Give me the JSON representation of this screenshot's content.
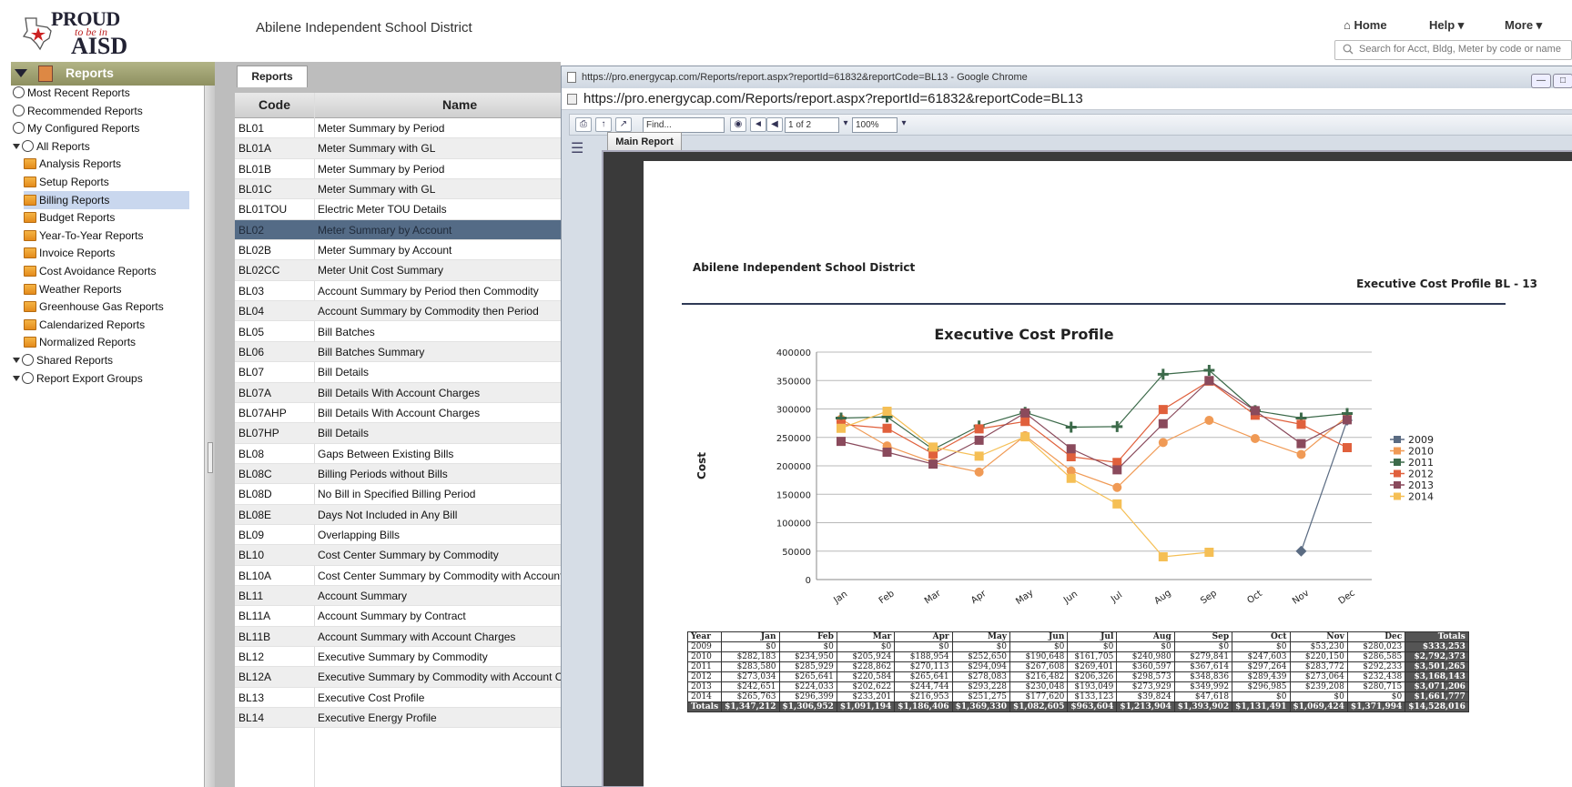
{
  "header": {
    "logo": {
      "line1": "PROUD",
      "line2": "to be in",
      "line3": "AISD"
    },
    "org_title": "Abilene Independent School District",
    "nav": {
      "home": "Home",
      "help": "Help",
      "more": "More"
    },
    "search_placeholder": "Search for Acct, Bldg, Meter by code or name"
  },
  "sidebar": {
    "title": "Reports",
    "items": [
      {
        "label": "Most Recent Reports",
        "icon": "clock-icon",
        "indent": 0
      },
      {
        "label": "Recommended Reports",
        "icon": "star-doc-icon",
        "indent": 0
      },
      {
        "label": "My Configured Reports",
        "icon": "gear-users-icon",
        "indent": 0
      },
      {
        "label": "All Reports",
        "icon": "reports-group-icon",
        "indent": 0,
        "expanded": true
      },
      {
        "label": "Analysis Reports",
        "icon": "folder-icon",
        "indent": 1
      },
      {
        "label": "Setup Reports",
        "icon": "folder-icon",
        "indent": 1
      },
      {
        "label": "Billing Reports",
        "icon": "folder-icon",
        "indent": 1,
        "selected": true
      },
      {
        "label": "Budget Reports",
        "icon": "folder-icon",
        "indent": 1
      },
      {
        "label": "Year-To-Year Reports",
        "icon": "folder-icon",
        "indent": 1
      },
      {
        "label": "Invoice Reports",
        "icon": "folder-icon",
        "indent": 1
      },
      {
        "label": "Cost Avoidance Reports",
        "icon": "folder-icon",
        "indent": 1
      },
      {
        "label": "Weather Reports",
        "icon": "folder-icon",
        "indent": 1
      },
      {
        "label": "Greenhouse Gas Reports",
        "icon": "folder-icon",
        "indent": 1
      },
      {
        "label": "Calendarized Reports",
        "icon": "folder-icon",
        "indent": 1
      },
      {
        "label": "Normalized Reports",
        "icon": "folder-icon",
        "indent": 1
      },
      {
        "label": "Shared Reports",
        "icon": "shared-icon",
        "indent": 0,
        "expanded": true
      },
      {
        "label": "Report Export Groups",
        "icon": "export-icon",
        "indent": 0,
        "expanded": true
      }
    ]
  },
  "report_list": {
    "tab": "Reports",
    "columns": {
      "code": "Code",
      "name": "Name"
    },
    "rows": [
      {
        "code": "BL01",
        "name": "Meter Summary by Period"
      },
      {
        "code": "BL01A",
        "name": "Meter Summary with GL"
      },
      {
        "code": "BL01B",
        "name": "Meter Summary by Period"
      },
      {
        "code": "BL01C",
        "name": "Meter Summary with GL"
      },
      {
        "code": "BL01TOU",
        "name": "Electric Meter TOU Details"
      },
      {
        "code": "BL02",
        "name": "Meter Summary by Account",
        "selected": true
      },
      {
        "code": "BL02B",
        "name": "Meter Summary by Account"
      },
      {
        "code": "BL02CC",
        "name": "Meter Unit Cost Summary"
      },
      {
        "code": "BL03",
        "name": "Account Summary by Period then Commodity"
      },
      {
        "code": "BL04",
        "name": "Account Summary by Commodity then Period"
      },
      {
        "code": "BL05",
        "name": "Bill Batches"
      },
      {
        "code": "BL06",
        "name": "Bill Batches Summary"
      },
      {
        "code": "BL07",
        "name": "Bill Details"
      },
      {
        "code": "BL07A",
        "name": "Bill Details With Account Charges"
      },
      {
        "code": "BL07AHP",
        "name": "Bill Details With Account Charges"
      },
      {
        "code": "BL07HP",
        "name": "Bill Details"
      },
      {
        "code": "BL08",
        "name": "Gaps Between Existing Bills"
      },
      {
        "code": "BL08C",
        "name": "Billing Periods without Bills"
      },
      {
        "code": "BL08D",
        "name": "No Bill in Specified Billing Period"
      },
      {
        "code": "BL08E",
        "name": "Days Not Included in Any Bill"
      },
      {
        "code": "BL09",
        "name": "Overlapping Bills"
      },
      {
        "code": "BL10",
        "name": "Cost Center Summary by Commodity"
      },
      {
        "code": "BL10A",
        "name": "Cost Center Summary by Commodity with Account"
      },
      {
        "code": "BL11",
        "name": "Account Summary"
      },
      {
        "code": "BL11A",
        "name": "Account Summary by Contract"
      },
      {
        "code": "BL11B",
        "name": "Account Summary with Account Charges"
      },
      {
        "code": "BL12",
        "name": "Executive Summary by Commodity"
      },
      {
        "code": "BL12A",
        "name": "Executive Summary by Commodity with Account C"
      },
      {
        "code": "BL13",
        "name": "Executive Cost Profile"
      },
      {
        "code": "BL14",
        "name": "Executive Energy Profile"
      }
    ]
  },
  "browser": {
    "window_title": "https://pro.energycap.com/Reports/report.aspx?reportId=61832&reportCode=BL13 - Google Chrome",
    "url": "https://pro.energycap.com/Reports/report.aspx?reportId=61832&reportCode=BL13",
    "toolbar": {
      "find_placeholder": "Find...",
      "page": "1 of 2",
      "zoom": "100%"
    },
    "doc_tab": "Main Report"
  },
  "report": {
    "org": "Abilene Independent School District",
    "code_title": "Executive Cost Profile BL - 13"
  },
  "colors": {
    "2009": "#5a6b82",
    "2010": "#f09a55",
    "2011": "#3c6a4a",
    "2012": "#e0603c",
    "2013": "#8a4a5c",
    "2014": "#f5bf55"
  },
  "chart_data": {
    "type": "line",
    "title": "Executive Cost Profile",
    "xlabel": "",
    "ylabel": "Cost",
    "ylim": [
      0,
      400000
    ],
    "yticks": [
      0,
      50000,
      100000,
      150000,
      200000,
      250000,
      300000,
      350000,
      400000
    ],
    "grid": true,
    "legend": "right",
    "categories": [
      "Jan",
      "Feb",
      "Mar",
      "Apr",
      "May",
      "Jun",
      "Jul",
      "Aug",
      "Sep",
      "Oct",
      "Nov",
      "Dec"
    ],
    "series": [
      {
        "name": "2009",
        "values": [
          null,
          null,
          null,
          null,
          null,
          null,
          null,
          null,
          null,
          null,
          50000,
          280000
        ]
      },
      {
        "name": "2010",
        "values": [
          282000,
          235000,
          206000,
          189000,
          253000,
          191000,
          162000,
          241000,
          280000,
          248000,
          220000,
          287000
        ]
      },
      {
        "name": "2011",
        "values": [
          284000,
          286000,
          229000,
          270000,
          294000,
          268000,
          269000,
          361000,
          368000,
          297000,
          284000,
          292000
        ]
      },
      {
        "name": "2012",
        "values": [
          273000,
          266000,
          221000,
          265000,
          278000,
          216000,
          206000,
          299000,
          349000,
          289000,
          273000,
          232000
        ]
      },
      {
        "name": "2013",
        "values": [
          243000,
          224000,
          203000,
          245000,
          293000,
          230000,
          193000,
          274000,
          350000,
          297000,
          239000,
          281000
        ]
      },
      {
        "name": "2014",
        "values": [
          266000,
          296000,
          233000,
          217000,
          251000,
          178000,
          133000,
          40000,
          48000,
          null,
          null,
          null
        ]
      }
    ],
    "table": {
      "header": [
        "Year",
        "Jan",
        "Feb",
        "Mar",
        "Apr",
        "May",
        "Jun",
        "Jul",
        "Aug",
        "Sep",
        "Oct",
        "Nov",
        "Dec",
        "Totals"
      ],
      "rows": [
        [
          "2009",
          "$0",
          "$0",
          "$0",
          "$0",
          "$0",
          "$0",
          "$0",
          "$0",
          "$0",
          "$0",
          "$53,230",
          "$280,023",
          "$333,253"
        ],
        [
          "2010",
          "$282,183",
          "$234,950",
          "$205,924",
          "$188,954",
          "$252,650",
          "$190,648",
          "$161,705",
          "$240,980",
          "$279,841",
          "$247,603",
          "$220,150",
          "$286,585",
          "$2,792,373"
        ],
        [
          "2011",
          "$283,580",
          "$285,929",
          "$228,862",
          "$270,113",
          "$294,094",
          "$267,608",
          "$269,401",
          "$360,597",
          "$367,614",
          "$297,264",
          "$283,772",
          "$292,233",
          "$3,501,265"
        ],
        [
          "2012",
          "$273,034",
          "$265,641",
          "$220,584",
          "$265,641",
          "$278,083",
          "$216,482",
          "$206,326",
          "$298,573",
          "$348,836",
          "$289,439",
          "$273,064",
          "$232,438",
          "$3,168,143"
        ],
        [
          "2013",
          "$242,651",
          "$224,033",
          "$202,622",
          "$244,744",
          "$293,228",
          "$230,048",
          "$193,049",
          "$273,929",
          "$349,992",
          "$296,985",
          "$239,208",
          "$280,715",
          "$3,071,206"
        ],
        [
          "2014",
          "$265,763",
          "$296,399",
          "$233,201",
          "$216,953",
          "$251,275",
          "$177,620",
          "$133,123",
          "$39,824",
          "$47,618",
          "$0",
          "$0",
          "$0",
          "$1,661,777"
        ]
      ],
      "totals": [
        "Totals",
        "$1,347,212",
        "$1,306,952",
        "$1,091,194",
        "$1,186,406",
        "$1,369,330",
        "$1,082,605",
        "$963,604",
        "$1,213,904",
        "$1,393,902",
        "$1,131,491",
        "$1,069,424",
        "$1,371,994",
        "$14,528,016"
      ]
    }
  }
}
